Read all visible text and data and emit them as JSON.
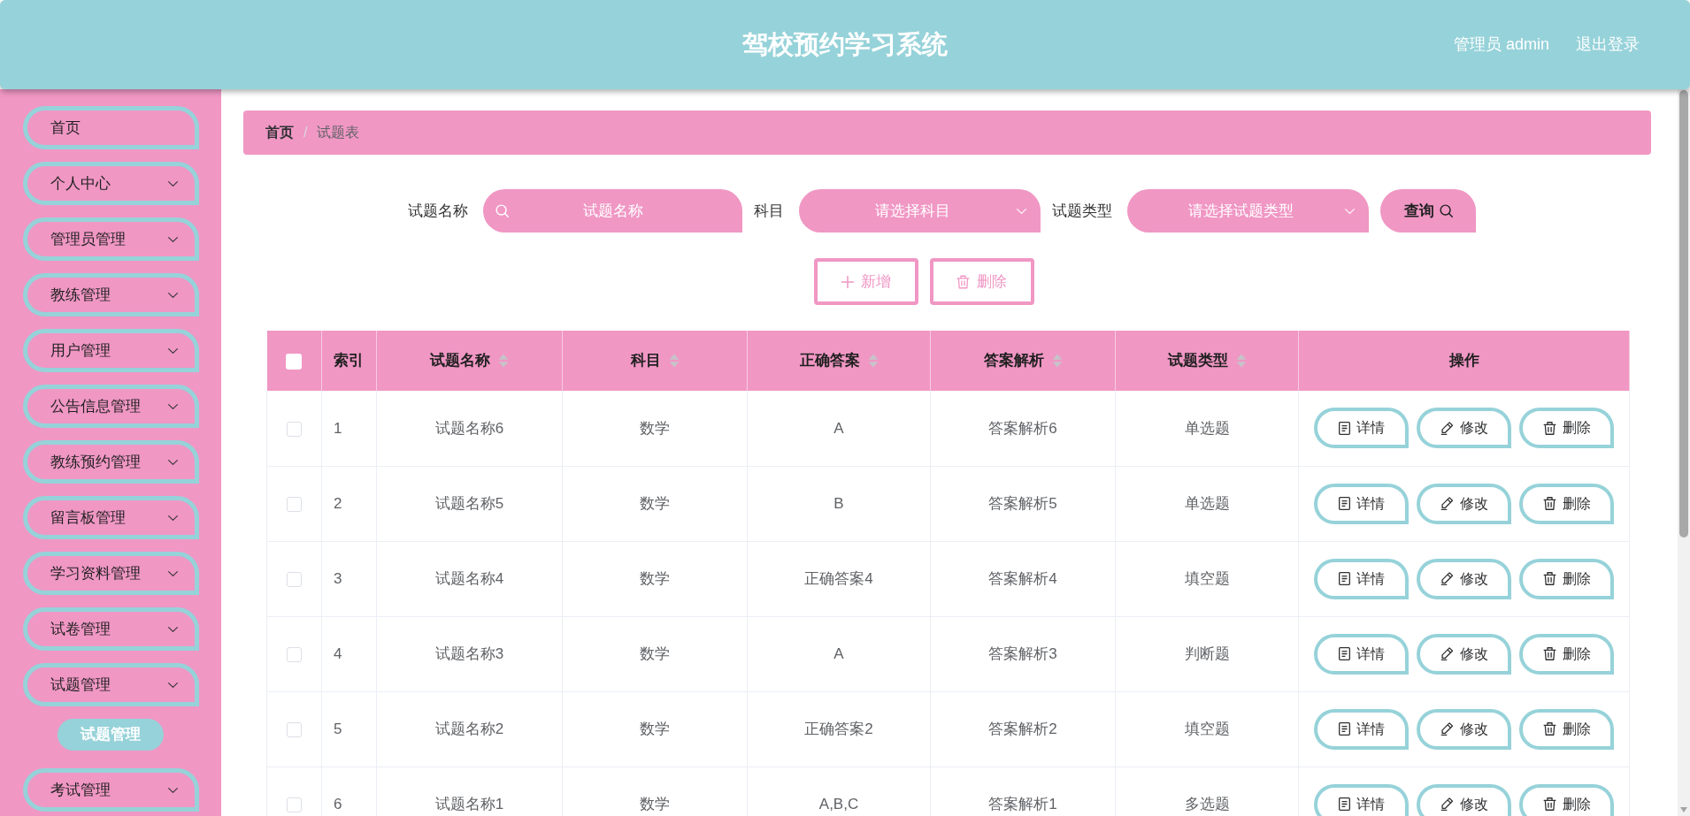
{
  "header": {
    "title": "驾校预约学习系统",
    "user": "管理员 admin",
    "logout": "退出登录"
  },
  "sidebar": {
    "items": [
      {
        "kind": "link",
        "label": "首页"
      },
      {
        "kind": "submenu",
        "label": "个人中心"
      },
      {
        "kind": "submenu",
        "label": "管理员管理"
      },
      {
        "kind": "submenu",
        "label": "教练管理"
      },
      {
        "kind": "submenu",
        "label": "用户管理"
      },
      {
        "kind": "submenu",
        "label": "公告信息管理"
      },
      {
        "kind": "submenu",
        "label": "教练预约管理"
      },
      {
        "kind": "submenu",
        "label": "留言板管理"
      },
      {
        "kind": "submenu",
        "label": "学习资料管理"
      },
      {
        "kind": "submenu",
        "label": "试卷管理"
      },
      {
        "kind": "submenu",
        "label": "试题管理",
        "children": [
          {
            "label": "试题管理",
            "selected": true
          }
        ]
      },
      {
        "kind": "submenu",
        "label": "考试管理"
      }
    ]
  },
  "breadcrumb": {
    "separator": "/",
    "items": [
      {
        "label": "首页",
        "current": false
      },
      {
        "label": "试题表",
        "current": true
      }
    ]
  },
  "search": {
    "fields": [
      {
        "kind": "text",
        "label": "试题名称",
        "placeholder": "试题名称"
      },
      {
        "kind": "select",
        "label": "科目",
        "placeholder": "请选择科目"
      },
      {
        "kind": "select",
        "label": "试题类型",
        "placeholder": "请选择试题类型"
      }
    ],
    "button": "查询"
  },
  "actions": [
    {
      "kind": "add",
      "label": "新增"
    },
    {
      "kind": "delete",
      "label": "删除"
    }
  ],
  "table": {
    "select_all": {
      "checked": false
    },
    "columns": [
      {
        "kind": "index",
        "label": "索引"
      },
      {
        "kind": "sortable",
        "label": "试题名称"
      },
      {
        "kind": "sortable",
        "label": "科目"
      },
      {
        "kind": "sortable",
        "label": "正确答案"
      },
      {
        "kind": "sortable",
        "label": "答案解析"
      },
      {
        "kind": "sortable",
        "label": "试题类型"
      },
      {
        "kind": "plain",
        "label": "操作"
      }
    ],
    "rows": [
      {
        "checked": false,
        "cells": [
          "1",
          "试题名称6",
          "数学",
          "A",
          "答案解析6",
          "单选题"
        ],
        "actions": [
          {
            "kind": "detail",
            "label": "详情"
          },
          {
            "kind": "edit",
            "label": "修改"
          },
          {
            "kind": "delete",
            "label": "删除"
          }
        ]
      },
      {
        "checked": false,
        "cells": [
          "2",
          "试题名称5",
          "数学",
          "B",
          "答案解析5",
          "单选题"
        ],
        "actions": [
          {
            "kind": "detail",
            "label": "详情"
          },
          {
            "kind": "edit",
            "label": "修改"
          },
          {
            "kind": "delete",
            "label": "删除"
          }
        ]
      },
      {
        "checked": false,
        "cells": [
          "3",
          "试题名称4",
          "数学",
          "正确答案4",
          "答案解析4",
          "填空题"
        ],
        "actions": [
          {
            "kind": "detail",
            "label": "详情"
          },
          {
            "kind": "edit",
            "label": "修改"
          },
          {
            "kind": "delete",
            "label": "删除"
          }
        ]
      },
      {
        "checked": false,
        "cells": [
          "4",
          "试题名称3",
          "数学",
          "A",
          "答案解析3",
          "判断题"
        ],
        "actions": [
          {
            "kind": "detail",
            "label": "详情"
          },
          {
            "kind": "edit",
            "label": "修改"
          },
          {
            "kind": "delete",
            "label": "删除"
          }
        ]
      },
      {
        "checked": false,
        "cells": [
          "5",
          "试题名称2",
          "数学",
          "正确答案2",
          "答案解析2",
          "填空题"
        ],
        "actions": [
          {
            "kind": "detail",
            "label": "详情"
          },
          {
            "kind": "edit",
            "label": "修改"
          },
          {
            "kind": "delete",
            "label": "删除"
          }
        ]
      },
      {
        "checked": false,
        "cells": [
          "6",
          "试题名称1",
          "数学",
          "A,B,C",
          "答案解析1",
          "多选题"
        ],
        "actions": [
          {
            "kind": "detail",
            "label": "详情"
          },
          {
            "kind": "edit",
            "label": "修改"
          },
          {
            "kind": "delete",
            "label": "删除"
          }
        ]
      }
    ]
  }
}
